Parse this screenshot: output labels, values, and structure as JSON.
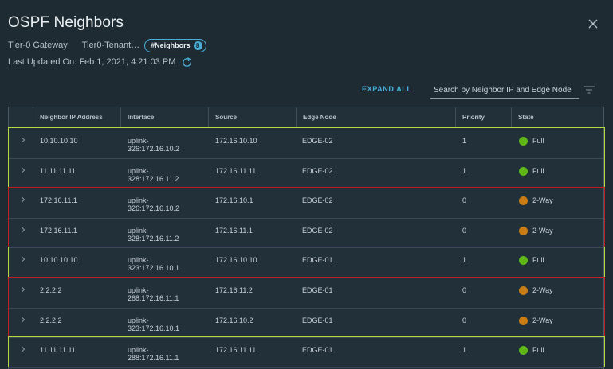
{
  "header": {
    "title": "OSPF Neighbors",
    "gateway_type": "Tier-0 Gateway",
    "gateway_name": "Tier0-Tenant…",
    "pill_label": "#Neighbors",
    "pill_count": "8",
    "last_updated": "Last Updated On: Feb 1, 2021, 4:21:03 PM"
  },
  "toolbar": {
    "expand_all": "EXPAND ALL",
    "search_placeholder": "Search by Neighbor IP and Edge Node"
  },
  "table": {
    "columns": [
      "Neighbor IP Address",
      "Interface",
      "Source",
      "Edge Node",
      "Priority",
      "State"
    ],
    "rows": [
      {
        "neighbor_ip": "10.10.10.10",
        "interface_1": "uplink-",
        "interface_2": "326:172.16.10.2",
        "source": "172.16.10.10",
        "edge_node": "EDGE-02",
        "priority": "1",
        "state": "Full"
      },
      {
        "neighbor_ip": "11.11.11.11",
        "interface_1": "uplink-",
        "interface_2": "328:172.16.11.2",
        "source": "172.16.11.11",
        "edge_node": "EDGE-02",
        "priority": "1",
        "state": "Full"
      },
      {
        "neighbor_ip": "172.16.11.1",
        "interface_1": "uplink-",
        "interface_2": "326:172.16.10.2",
        "source": "172.16.10.1",
        "edge_node": "EDGE-02",
        "priority": "0",
        "state": "2-Way"
      },
      {
        "neighbor_ip": "172.16.11.1",
        "interface_1": "uplink-",
        "interface_2": "328:172.16.11.2",
        "source": "172.16.11.1",
        "edge_node": "EDGE-02",
        "priority": "0",
        "state": "2-Way"
      },
      {
        "neighbor_ip": "10.10.10.10",
        "interface_1": "uplink-",
        "interface_2": "323:172.16.10.1",
        "source": "172.16.10.10",
        "edge_node": "EDGE-01",
        "priority": "1",
        "state": "Full"
      },
      {
        "neighbor_ip": "2.2.2.2",
        "interface_1": "uplink-",
        "interface_2": "288:172.16.11.1",
        "source": "172.16.11.2",
        "edge_node": "EDGE-01",
        "priority": "0",
        "state": "2-Way"
      },
      {
        "neighbor_ip": "2.2.2.2",
        "interface_1": "uplink-",
        "interface_2": "323:172.16.10.1",
        "source": "172.16.10.2",
        "edge_node": "EDGE-01",
        "priority": "0",
        "state": "2-Way"
      },
      {
        "neighbor_ip": "11.11.11.11",
        "interface_1": "uplink-",
        "interface_2": "288:172.16.11.1",
        "source": "172.16.11.11",
        "edge_node": "EDGE-01",
        "priority": "1",
        "state": "Full"
      }
    ]
  },
  "colors": {
    "background": "#1f2b33",
    "accent": "#49afd9",
    "state_full": "#5eb715",
    "state_2way": "#c77d13",
    "highlight_green": "#b5d844",
    "highlight_red": "#c21d22"
  },
  "icons": {
    "close": "close-icon",
    "refresh": "refresh-icon",
    "filter": "filter-icon",
    "expand_row": "chevron-right-icon"
  }
}
